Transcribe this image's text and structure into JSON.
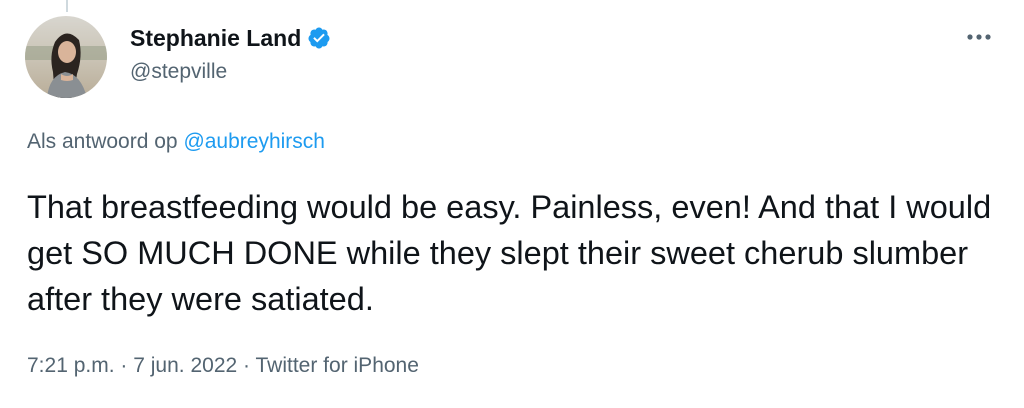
{
  "author": {
    "display_name": "Stephanie Land",
    "handle": "@stepville",
    "verified": true,
    "avatar_icon": "profile-photo"
  },
  "more_icon": "more-horizontal-icon",
  "reply": {
    "prefix": "Als antwoord op",
    "mention": "@aubreyhirsch"
  },
  "tweet": {
    "text": "That breastfeeding would be easy. Painless, even! And that I would get SO MUCH DONE while they slept their sweet cherub slumber after they were satiated."
  },
  "meta": {
    "time": "7:21 p.m.",
    "separator_1": "·",
    "date": "7 jun. 2022",
    "separator_2": "·",
    "source": "Twitter for iPhone"
  },
  "colors": {
    "text_primary": "#0f1419",
    "text_secondary": "#536471",
    "accent": "#1d9bf0",
    "thread_line": "#cfd9de"
  }
}
